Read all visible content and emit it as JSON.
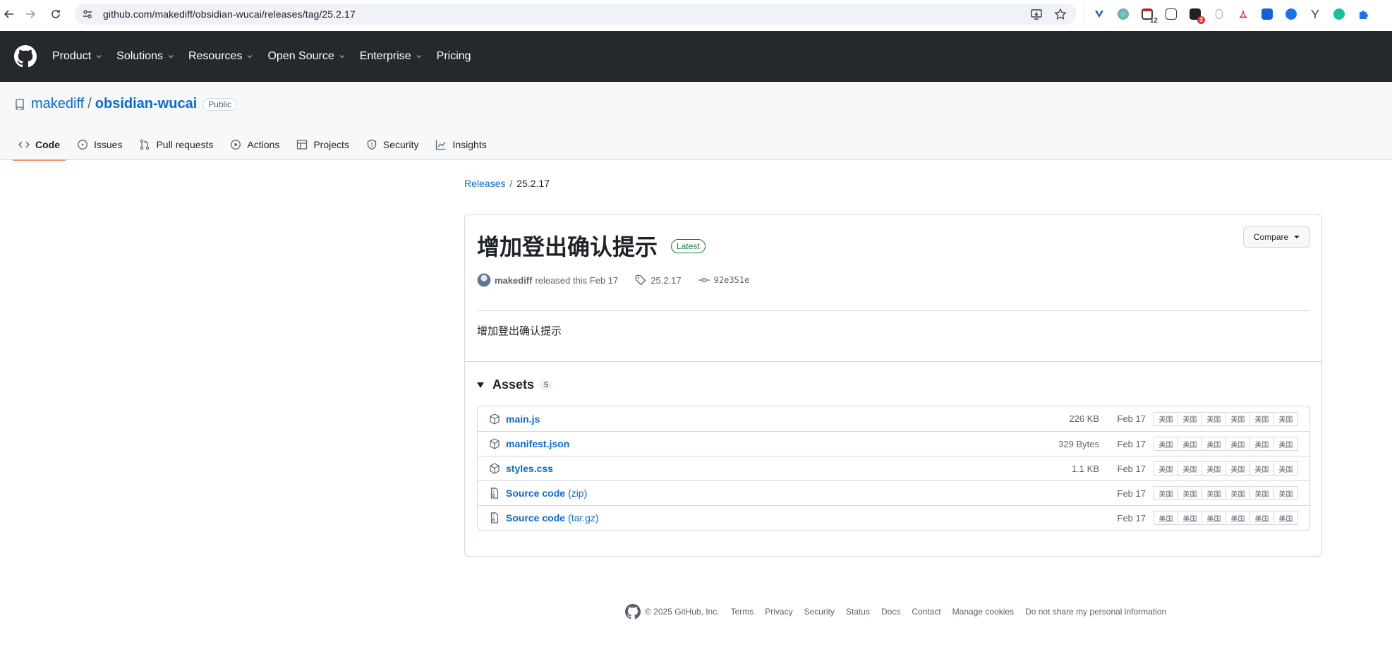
{
  "browser": {
    "url": "github.com/makediff/obsidian-wucai/releases/tag/25.2.17",
    "extension_badges": {
      "calendar": "12",
      "mail": "3"
    }
  },
  "header": {
    "nav": [
      "Product",
      "Solutions",
      "Resources",
      "Open Source",
      "Enterprise",
      "Pricing"
    ]
  },
  "repo": {
    "owner": "makediff",
    "separator": "/",
    "name": "obsidian-wucai",
    "visibility": "Public",
    "tabs": [
      "Code",
      "Issues",
      "Pull requests",
      "Actions",
      "Projects",
      "Security",
      "Insights"
    ]
  },
  "breadcrumb": {
    "releases": "Releases",
    "separator": "/",
    "current": "25.2.17"
  },
  "release": {
    "title": "增加登出确认提示",
    "badge": "Latest",
    "compare_label": "Compare",
    "author": "makediff",
    "released_text": "released this Feb 17",
    "tag": "25.2.17",
    "commit": "92e351e",
    "body": "增加登出确认提示"
  },
  "assets": {
    "label": "Assets",
    "count": "5",
    "mirror_label": "美国",
    "items": [
      {
        "name": "main.js",
        "suffix": "",
        "size": "226 KB",
        "date": "Feb 17",
        "icon": "package-icon"
      },
      {
        "name": "manifest.json",
        "suffix": "",
        "size": "329 Bytes",
        "date": "Feb 17",
        "icon": "package-icon"
      },
      {
        "name": "styles.css",
        "suffix": "",
        "size": "1.1 KB",
        "date": "Feb 17",
        "icon": "package-icon"
      },
      {
        "name": "Source code",
        "suffix": "(zip)",
        "size": "",
        "date": "Feb 17",
        "icon": "file-zip-icon"
      },
      {
        "name": "Source code",
        "suffix": "(tar.gz)",
        "size": "",
        "date": "Feb 17",
        "icon": "file-zip-icon"
      }
    ]
  },
  "footer": {
    "copyright": "© 2025 GitHub, Inc.",
    "links": [
      "Terms",
      "Privacy",
      "Security",
      "Status",
      "Docs",
      "Contact",
      "Manage cookies",
      "Do not share my personal information"
    ]
  }
}
